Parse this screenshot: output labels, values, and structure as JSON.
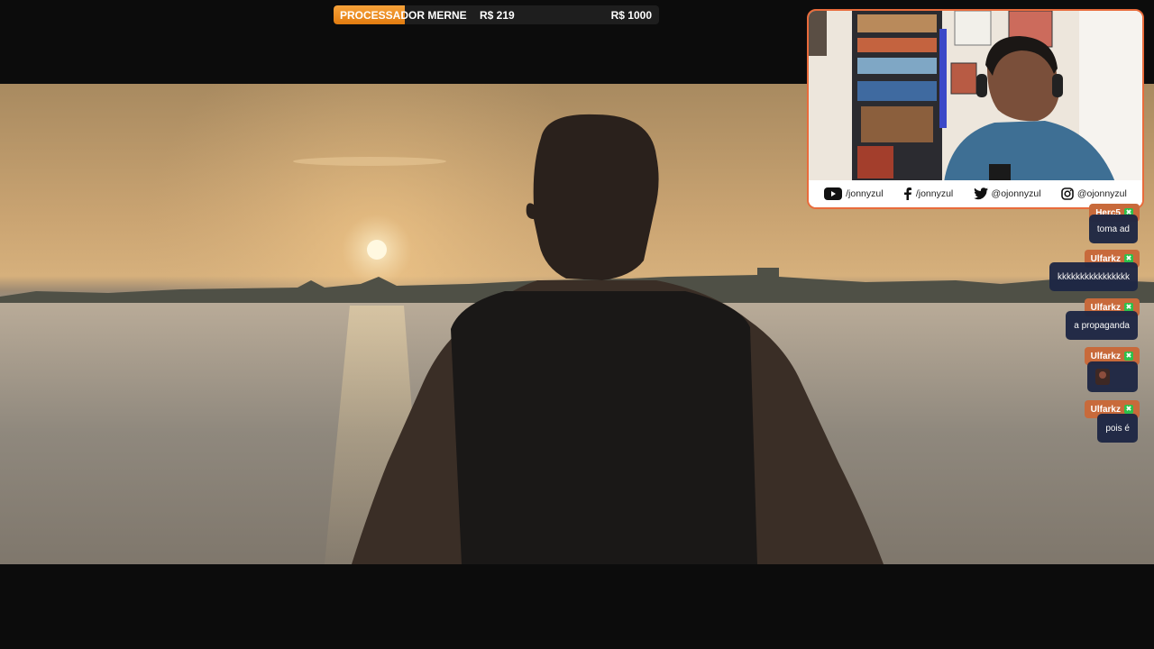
{
  "goal": {
    "title": "PROCESSADOR MERNE",
    "current": "R$ 219",
    "target": "R$ 1000",
    "progress_fraction": 0.219,
    "fill_color": "#f39a2e"
  },
  "video": {
    "scene": "sunset-over-water-man-from-behind"
  },
  "webcam": {
    "border_color": "#e96b3b",
    "socials": [
      {
        "icon": "youtube-icon",
        "handle": "/jonnyzul"
      },
      {
        "icon": "facebook-icon",
        "handle": "/jonnyzul"
      },
      {
        "icon": "twitter-icon",
        "handle": "@ojonnyzul"
      },
      {
        "icon": "instagram-icon",
        "handle": "@ojonnyzul"
      }
    ]
  },
  "chat": {
    "messages": [
      {
        "user": "Herc5",
        "text": "toma ad"
      },
      {
        "user": "Ulfarkz",
        "text": "kkkkkkkkkkkkkkkk"
      },
      {
        "user": "Ulfarkz",
        "text": "a propaganda"
      },
      {
        "user": "Ulfarkz",
        "text": "",
        "emote": "emote-icon"
      },
      {
        "user": "Ulfarkz",
        "text": "pois é"
      }
    ],
    "mod_badge": "✖",
    "name_color": "#c86a3b",
    "bubble_color": "#1e2744"
  }
}
